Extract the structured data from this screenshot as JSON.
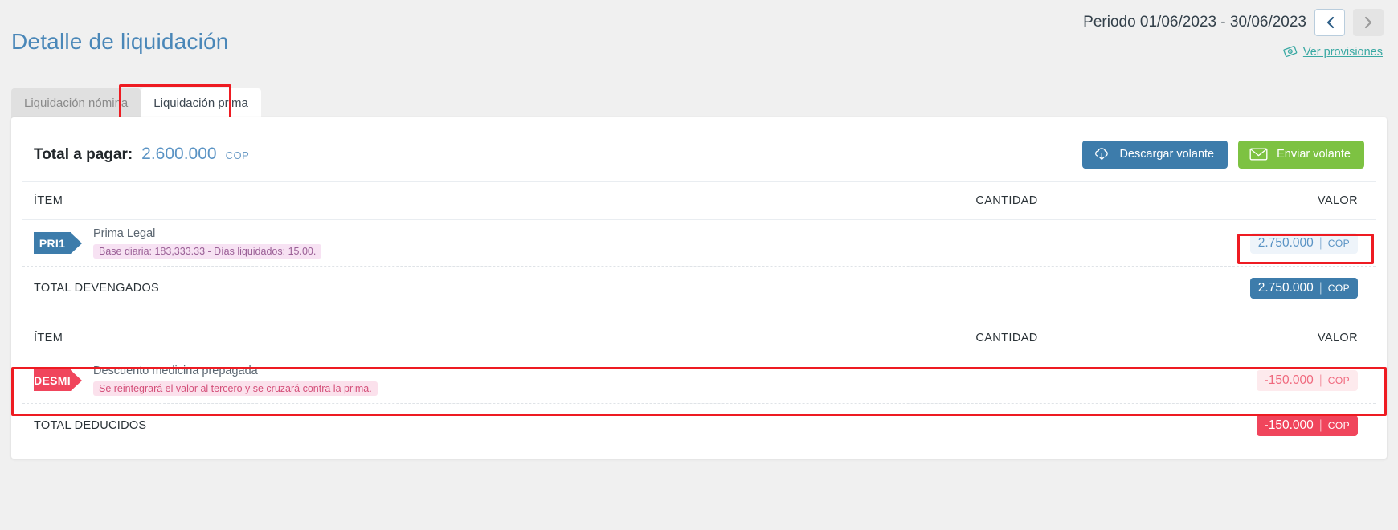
{
  "header": {
    "title": "Detalle de liquidación",
    "period_label": "Periodo 01/06/2023 - 30/06/2023",
    "prev_icon": "chevron-left-icon",
    "next_icon": "chevron-right-icon",
    "provisions_link": "Ver provisiones",
    "provisions_icon": "money-bill-icon"
  },
  "tabs": [
    {
      "label": "Liquidación nómina",
      "active": false
    },
    {
      "label": "Liquidación prima",
      "active": true
    }
  ],
  "summary": {
    "total_label": "Total a pagar:",
    "total_amount": "2.600.000",
    "currency": "COP",
    "download_button": "Descargar volante",
    "download_icon": "cloud-download-icon",
    "send_button": "Enviar volante",
    "send_icon": "envelope-icon"
  },
  "earnings": {
    "columns": {
      "item": "ÍTEM",
      "quantity": "CANTIDAD",
      "value": "VALOR"
    },
    "rows": [
      {
        "code": "PRI1",
        "name": "Prima Legal",
        "note": "Base diaria: 183,333.33 - Días liquidados: 15.00.",
        "quantity": "",
        "value": "2.750.000",
        "currency": "COP"
      }
    ],
    "total_label": "TOTAL DEVENGADOS",
    "total_value": "2.750.000",
    "total_currency": "COP"
  },
  "deductions": {
    "columns": {
      "item": "ÍTEM",
      "quantity": "CANTIDAD",
      "value": "VALOR"
    },
    "rows": [
      {
        "code": "DESMI",
        "name": "Descuento medicina prepagada",
        "note": "Se reintegrará el valor al tercero y se cruzará contra la prima.",
        "quantity": "",
        "value": "-150.000",
        "currency": "COP"
      }
    ],
    "total_label": "TOTAL DEDUCIDOS",
    "total_value": "-150.000",
    "total_currency": "COP"
  },
  "colors": {
    "accent_blue": "#3d7cab",
    "title_blue": "#4a87b8",
    "green": "#7dc242",
    "red": "#f0455c",
    "teal_link": "#3aa9a3",
    "highlight": "#ee1b22"
  }
}
